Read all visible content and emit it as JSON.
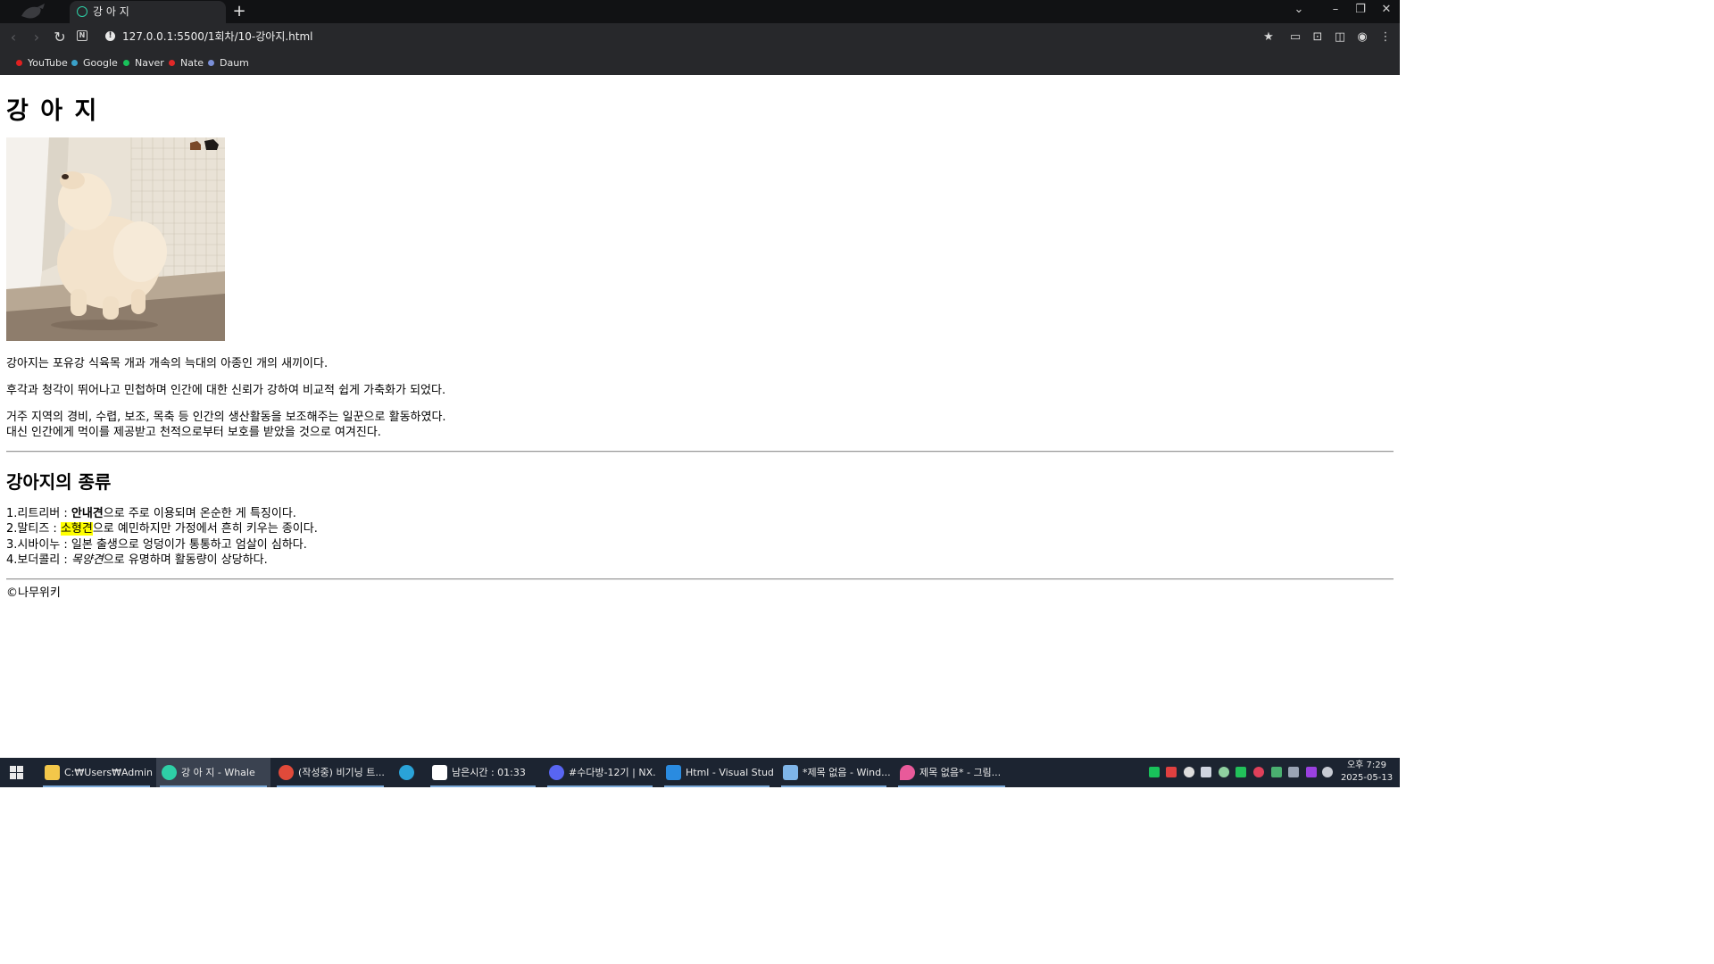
{
  "browser": {
    "tab_title": "강 아 지",
    "new_tab_symbol": "+",
    "url": "127.0.0.1:5500/1회차/10-강아지.html",
    "bookmarks": [
      {
        "label": "YouTube",
        "color": "#e02020"
      },
      {
        "label": "Google",
        "color": "#3aa0c8"
      },
      {
        "label": "Naver",
        "color": "#19c15a"
      },
      {
        "label": "Nate",
        "color": "#e02828"
      },
      {
        "label": "Daum",
        "color": "#7a8fd8"
      }
    ]
  },
  "page": {
    "title": "강 아 지",
    "image_alt": "crouching puppy",
    "paragraphs": [
      "강아지는 포유강 식육목 개과 개속의 늑대의 아종인 개의 새끼이다.",
      "후각과 청각이 뛰어나고 민첩하며 인간에 대한 신뢰가 강하여 비교적 쉽게 가축화가 되었다.",
      "거주 지역의 경비, 수렵, 보조, 목축 등 인간의 생산활동을 보조해주는 일꾼으로 활동하였다.",
      "대신 인간에게 먹이를 제공받고 천적으로부터 보호를 받았을 것으로 여겨진다."
    ],
    "section_title": "강아지의 종류",
    "breeds": [
      {
        "prefix": "1.리트리버 : ",
        "em": "안내견",
        "suffix": "으로 주로 이용되며 온순한 게 특징이다."
      },
      {
        "prefix": "2.말티즈 : ",
        "em": "소형견",
        "suffix": "으로 예민하지만 가정에서 흔히 키우는 종이다."
      },
      {
        "prefix": "3.시바이누 : 일본 출생으로 엉덩이가 통통하고 엄살이 심하다.",
        "em": "",
        "suffix": ""
      },
      {
        "prefix": "4.보더콜리 : ",
        "em": "목양견",
        "suffix": "으로 유명하며 활동량이 상당하다."
      }
    ],
    "footer": "©나무위키"
  },
  "taskbar": {
    "items": [
      {
        "label": "C:₩Users₩Adminis...",
        "color": "#f3c74a"
      },
      {
        "label": "강 아 지 - Whale",
        "color": "#2ecfa6"
      },
      {
        "label": "(작성중) 비기닝 트...",
        "color": "#e04a3a"
      },
      {
        "label": "",
        "color": "#2aa3d8"
      },
      {
        "label": "남은시간 : 01:33",
        "color": "#8a2be2"
      },
      {
        "label": "#수다방-12기 | NX...",
        "color": "#5865f2"
      },
      {
        "label": "Html - Visual Stud...",
        "color": "#2a8be0"
      },
      {
        "label": "*제목 없음 - Wind...",
        "color": "#7fb5e8"
      },
      {
        "label": "제목 없음* - 그림...",
        "color": "#e85a9a"
      }
    ],
    "time": "오후 7:29",
    "date": "2025-05-13"
  }
}
